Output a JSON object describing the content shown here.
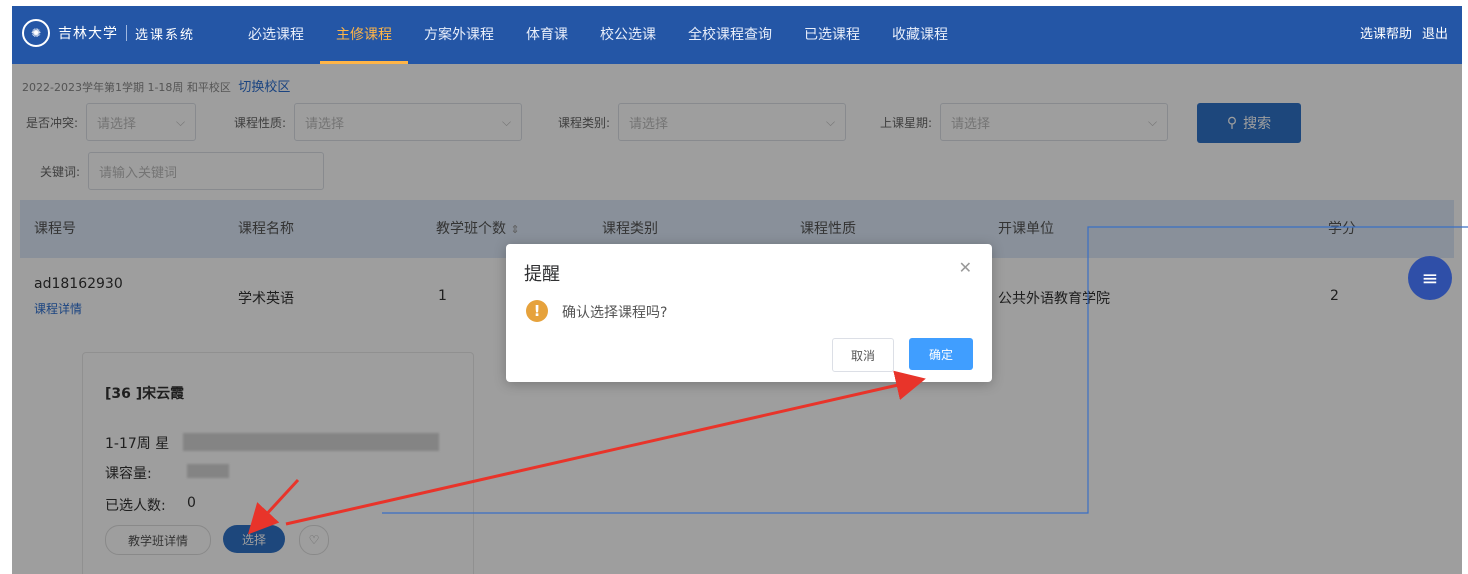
{
  "header": {
    "logo_name": "吉林大学",
    "system_name": "选课系统",
    "nav": [
      {
        "label": "必选课程"
      },
      {
        "label": "主修课程"
      },
      {
        "label": "方案外课程"
      },
      {
        "label": "体育课"
      },
      {
        "label": "校公选课"
      },
      {
        "label": "全校课程查询"
      },
      {
        "label": "已选课程"
      },
      {
        "label": "收藏课程"
      }
    ],
    "active_nav": "主修课程",
    "help": "选课帮助",
    "logout": "退出"
  },
  "term": {
    "text": "2022-2023学年第1学期  1-18周  和平校区",
    "switch_label": "切换校区"
  },
  "filters": {
    "conflict_label": "是否冲突:",
    "nature_label": "课程性质:",
    "category_label": "课程类别:",
    "weekday_label": "上课星期:",
    "keyword_label": "关键词:",
    "select_placeholder": "请选择",
    "keyword_placeholder": "请输入关键词",
    "search_label": "搜索"
  },
  "table": {
    "headers": [
      "课程号",
      "课程名称",
      "教学班个数",
      "课程类别",
      "课程性质",
      "开课单位",
      "学分"
    ],
    "row": {
      "course_id": "ad18162930",
      "detail_link": "课程详情",
      "name": "学术英语",
      "class_count": "1",
      "department": "公共外语教育学院",
      "credit": "2"
    }
  },
  "card": {
    "teacher": "[36 ]宋云霞",
    "weeks": "1-17周 星",
    "capacity_label": "课容量:",
    "selected_label": "已选人数:",
    "selected_value": "0",
    "details_button": "教学班详情",
    "select_button": "选择"
  },
  "dialog": {
    "title": "提醒",
    "message": "确认选择课程吗?",
    "cancel": "取消",
    "confirm": "确定"
  },
  "colors": {
    "nav_bg": "#2456a6",
    "active_nav": "#ffb547",
    "primary": "#2f73c9",
    "warning": "#e6a23c",
    "annotation": "#e8342a"
  },
  "icons": [
    "logo-emblem-icon",
    "chevron-down-icon",
    "search-icon",
    "sort-icon",
    "warning-icon",
    "close-icon",
    "heart-icon",
    "menu-icon"
  ]
}
